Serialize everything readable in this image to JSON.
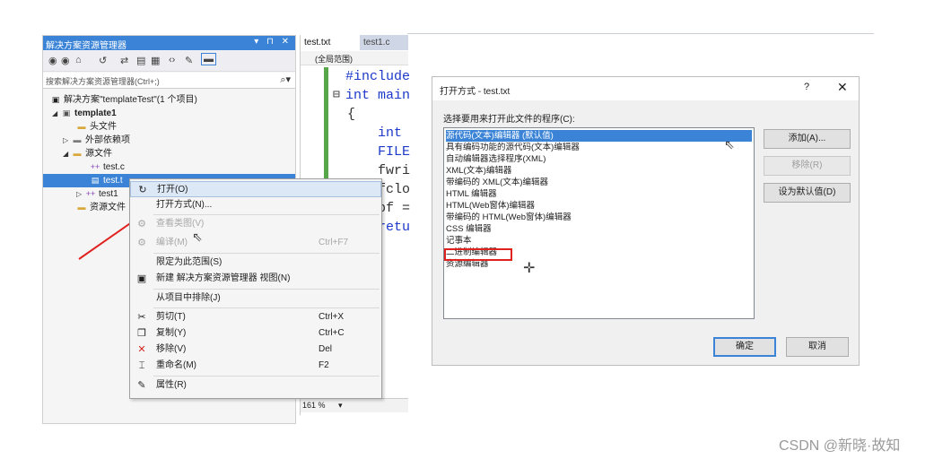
{
  "solution_explorer": {
    "title": "解决方案资源管理器",
    "title_buttons": "▾ ⊓ ✕",
    "toolbar_icons": [
      "back-icon",
      "forward-icon",
      "home-icon",
      "history-icon",
      "sync-icon",
      "collapse-icon",
      "show-files-icon",
      "code-view-icon",
      "properties-icon",
      "preview-icon"
    ],
    "search_placeholder": "搜索解决方案资源管理器(Ctrl+;)",
    "search_icon": "⌕▾",
    "tree": [
      {
        "label": "解决方案\"templateTest\"(1 个项目)",
        "icon": "solution-icon"
      },
      {
        "label": "template1",
        "icon": "project-icon",
        "arrow": "◢"
      },
      {
        "label": "头文件",
        "icon": "folder-icon"
      },
      {
        "label": "外部依赖项",
        "icon": "folder-icon",
        "arrow": "▷"
      },
      {
        "label": "源文件",
        "icon": "folder-icon",
        "arrow": "◢"
      },
      {
        "label": "test.c",
        "icon": "cpp-file-icon"
      },
      {
        "label": "test.t",
        "icon": "text-file-icon"
      },
      {
        "label": "test1",
        "icon": "cpp-file-icon",
        "arrow": "▷"
      },
      {
        "label": "资源文件",
        "icon": "folder-icon"
      }
    ]
  },
  "editor": {
    "tabs": [
      "test.txt",
      "test1.c"
    ],
    "scope": "(全局范围)",
    "lines": [
      "#include",
      "int main",
      "{",
      "int",
      "FILE",
      "fwri",
      "fclo",
      "pf =",
      "retu"
    ],
    "collapse_glyph": "⊟",
    "zoom": "161 %"
  },
  "context_menu": {
    "items": [
      {
        "label": "打开(O)",
        "icon": "↻",
        "state": "highlight"
      },
      {
        "label": "打开方式(N)...",
        "icon": ""
      },
      {
        "label": "查看类图(V)",
        "icon": "⚙",
        "state": "disabled"
      },
      {
        "label": "编译(M)",
        "icon": "⚙",
        "shortcut": "Ctrl+F7",
        "state": "disabled"
      },
      {
        "label": "限定为此范围(S)",
        "icon": ""
      },
      {
        "label": "新建 解决方案资源管理器 视图(N)",
        "icon": "▣"
      },
      {
        "label": "从项目中排除(J)",
        "icon": ""
      },
      {
        "label": "剪切(T)",
        "icon": "✂",
        "shortcut": "Ctrl+X"
      },
      {
        "label": "复制(Y)",
        "icon": "❐",
        "shortcut": "Ctrl+C"
      },
      {
        "label": "移除(V)",
        "icon": "✕",
        "shortcut": "Del"
      },
      {
        "label": "重命名(M)",
        "icon": "⌶",
        "shortcut": "F2"
      },
      {
        "label": "属性(R)",
        "icon": "🔧"
      }
    ]
  },
  "dialog": {
    "title": "打开方式 - test.txt",
    "help": "?",
    "close": "✕",
    "label": "选择要用来打开此文件的程序(C):",
    "programs": [
      "源代码(文本)编辑器 (默认值)",
      "具有编码功能的源代码(文本)编辑器",
      "自动编辑器选择程序(XML)",
      "XML(文本)编辑器",
      "带编码的 XML(文本)编辑器",
      "HTML 编辑器",
      "HTML(Web窗体)编辑器",
      "带编码的 HTML(Web窗体)编辑器",
      "CSS 编辑器",
      "记事本",
      "二进制编辑器",
      "资源编辑器"
    ],
    "buttons": {
      "add": "添加(A)...",
      "remove": "移除(R)",
      "set_default": "设为默认值(D)",
      "ok": "确定",
      "cancel": "取消"
    }
  },
  "watermark": "CSDN @新晓·故知",
  "colors": {
    "accent": "#3a83d6",
    "highlight_box": "#e0221f",
    "arrow": "#e0221f"
  }
}
